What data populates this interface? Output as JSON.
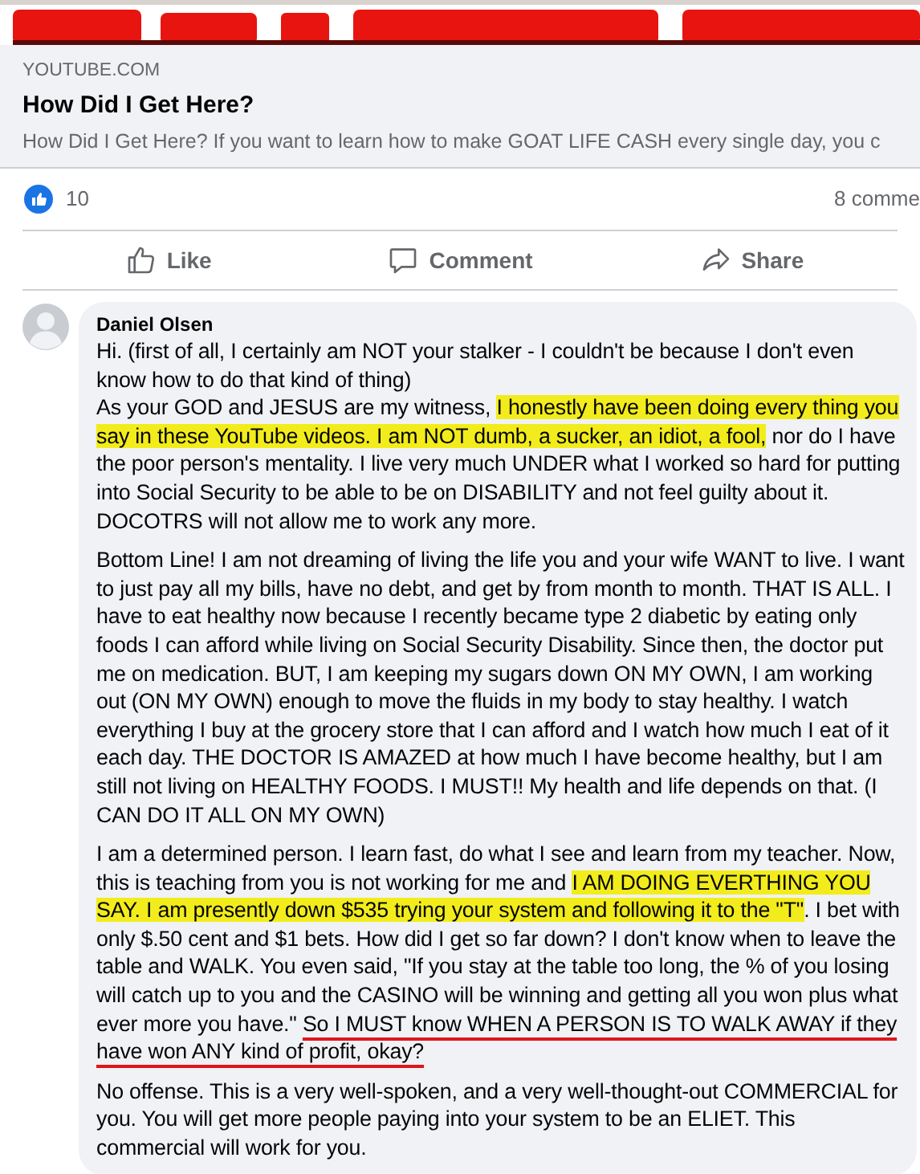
{
  "link_preview": {
    "domain": "YOUTUBE.COM",
    "title": "How Did I Get Here?",
    "description": "How Did I Get Here? If you want to learn how to make GOAT LIFE CASH every single day, you c"
  },
  "reactions": {
    "count": "10",
    "comments": "8 comme"
  },
  "actions": [
    {
      "label": "Like",
      "kind": "like"
    },
    {
      "label": "Comment",
      "kind": "comment"
    },
    {
      "label": "Share",
      "kind": "share"
    }
  ],
  "comment": {
    "author": "Daniel Olsen",
    "paragraphs": [
      [
        {
          "text": "Hi. (first of all, I certainly am NOT your stalker - I couldn't be because I don't even know how to do that kind of thing)",
          "kind": "plain"
        }
      ],
      [
        {
          "text": "As your GOD and JESUS are my witness, ",
          "kind": "plain"
        },
        {
          "text": "I honestly have been doing every thing you say in these YouTube videos. I am NOT dumb, a sucker, an idiot, a fool,",
          "kind": "highlight"
        },
        {
          "text": " nor do I have the poor person's mentality. I live very much UNDER what I worked so hard for putting into Social Security to be able to be on DISABILITY and not feel guilty about it. DOCOTRS will not allow me to work any more.",
          "kind": "plain"
        }
      ],
      [
        {
          "text": "Bottom Line! I am not dreaming of living the life you and your wife WANT to live. I want to just pay all my bills, have no debt, and get by from month to month. THAT IS ALL. I have to eat healthy now because I recently became type 2 diabetic by eating only foods I can afford while living on Social Security Disability. Since then, the doctor put me on medication. BUT, I am keeping my sugars down ON MY OWN, I am working out (ON MY OWN) enough to move the fluids in my body to stay healthy. I watch everything I buy at the grocery store that I can afford and I watch how much I eat of it each day. THE DOCTOR IS AMAZED at how much I have become healthy, but I am still not living on HEALTHY FOODS. I MUST!! My health and life depends on that. (I CAN DO IT ALL ON MY OWN)",
          "kind": "plain"
        }
      ],
      [
        {
          "text": "I am a determined person. I learn fast, do what I see and learn from my teacher. Now, this is teaching from you is not working for me and ",
          "kind": "plain"
        },
        {
          "text": "I AM DOING EVERTHING YOU SAY. I am presently down $535 trying your system and following it to the \"T\"",
          "kind": "highlight"
        },
        {
          "text": ". I bet with only $.50 cent and $1 bets. How did I get so far down? I don't know when to leave the table and WALK. You even said, \"If you stay at the table too long, the % of you losing will catch up to you and the CASINO will be winning and getting all you won plus what ever more you have.\" ",
          "kind": "plain"
        },
        {
          "text": "So I MUST know WHEN A PERSON IS TO WALK AWAY if they have won ANY kind of profit, okay?",
          "kind": "underline"
        }
      ],
      [
        {
          "text": "No offense. This is a very well-spoken, and a very well-thought-out COMMERCIAL for you. You will get more people paying into your system to be an ELIET. This commercial will work for you.",
          "kind": "plain"
        }
      ]
    ]
  }
}
